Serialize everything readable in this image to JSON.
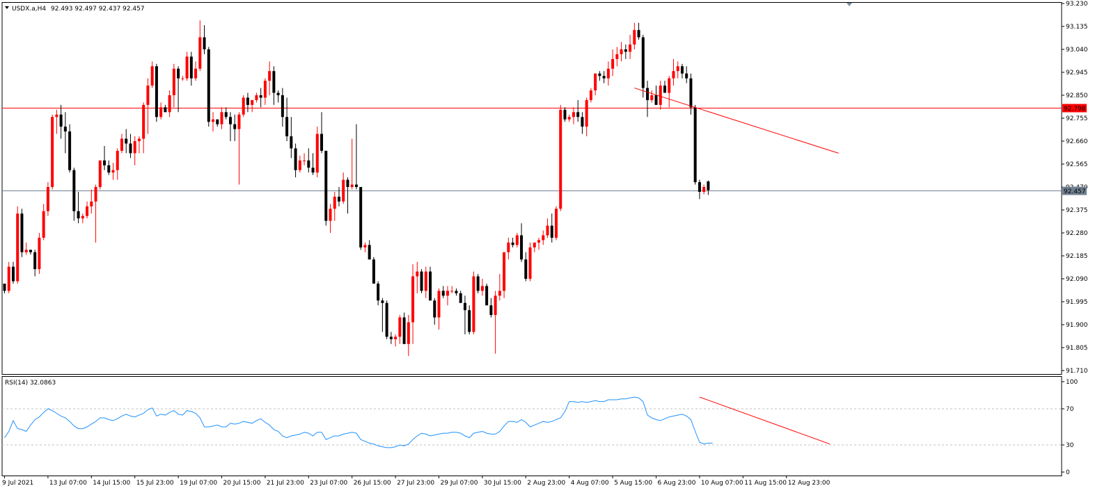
{
  "chart_data": [
    {
      "type": "candlestick",
      "symbol": "USDX.a,H4",
      "header_values": "92.493 92.497 92.437 92.457",
      "ylim": [
        91.71,
        93.23
      ],
      "y_ticks": [
        "93.230",
        "93.135",
        "93.040",
        "92.945",
        "92.850",
        "92.755",
        "92.660",
        "92.565",
        "92.470",
        "92.375",
        "92.280",
        "92.185",
        "92.090",
        "91.995",
        "91.900",
        "91.805",
        "91.710"
      ],
      "x_ticks": [
        "9 Jul 2021",
        "13 Jul 07:00",
        "14 Jul 15:00",
        "15 Jul 23:00",
        "19 Jul 07:00",
        "20 Jul 15:00",
        "21 Jul 23:00",
        "23 Jul 07:00",
        "26 Jul 15:00",
        "27 Jul 23:00",
        "29 Jul 07:00",
        "30 Jul 15:00",
        "2 Aug 23:00",
        "4 Aug 07:00",
        "5 Aug 15:00",
        "6 Aug 23:00",
        "10 Aug 07:00",
        "11 Aug 15:00",
        "12 Aug 23:00"
      ],
      "horizontal_lines": [
        {
          "label": "92.798",
          "price": 92.798,
          "color": "#ff0000"
        },
        {
          "label": "92.457",
          "price": 92.457,
          "color": "#708090"
        }
      ],
      "trendline": {
        "from": {
          "bar": 145,
          "price": 92.88
        },
        "to": {
          "bar": 192,
          "price": 92.61
        }
      },
      "up_color": "#ff0000",
      "down_color": "#000000",
      "candles": [
        [
          92.07,
          92.07,
          92.03,
          92.04
        ],
        [
          92.04,
          92.16,
          92.03,
          92.14
        ],
        [
          92.14,
          92.16,
          92.07,
          92.08
        ],
        [
          92.08,
          92.39,
          92.07,
          92.36
        ],
        [
          92.36,
          92.38,
          92.18,
          92.2
        ],
        [
          92.2,
          92.24,
          92.19,
          92.21
        ],
        [
          92.21,
          92.21,
          92.19,
          92.2
        ],
        [
          92.2,
          92.21,
          92.1,
          92.13
        ],
        [
          92.13,
          92.28,
          92.11,
          92.26
        ],
        [
          92.26,
          92.4,
          92.25,
          92.37
        ],
        [
          92.37,
          92.49,
          92.35,
          92.47
        ],
        [
          92.47,
          92.77,
          92.46,
          92.76
        ],
        [
          92.76,
          92.79,
          92.69,
          92.77
        ],
        [
          92.77,
          92.81,
          92.67,
          92.72
        ],
        [
          92.72,
          92.78,
          92.61,
          92.7
        ],
        [
          92.7,
          92.73,
          92.53,
          92.54
        ],
        [
          92.54,
          92.55,
          92.33,
          92.37
        ],
        [
          92.37,
          92.45,
          92.32,
          92.34
        ],
        [
          92.34,
          92.36,
          92.32,
          92.35
        ],
        [
          92.35,
          92.41,
          92.34,
          92.39
        ],
        [
          92.39,
          92.46,
          92.36,
          92.41
        ],
        [
          92.41,
          92.48,
          92.24,
          92.47
        ],
        [
          92.47,
          92.58,
          92.46,
          92.58
        ],
        [
          92.58,
          92.64,
          92.54,
          92.56
        ],
        [
          92.56,
          92.58,
          92.52,
          92.53
        ],
        [
          92.53,
          92.57,
          92.5,
          92.54
        ],
        [
          92.54,
          92.63,
          92.5,
          92.62
        ],
        [
          92.62,
          92.69,
          92.61,
          92.67
        ],
        [
          92.67,
          92.71,
          92.61,
          92.65
        ],
        [
          92.65,
          92.69,
          92.59,
          92.61
        ],
        [
          92.61,
          92.68,
          92.56,
          92.66
        ],
        [
          92.66,
          92.68,
          92.61,
          92.67
        ],
        [
          92.67,
          92.82,
          92.61,
          92.81
        ],
        [
          92.81,
          92.92,
          92.69,
          92.89
        ],
        [
          92.89,
          92.99,
          92.88,
          92.97
        ],
        [
          92.97,
          92.98,
          92.74,
          92.76
        ],
        [
          92.76,
          92.82,
          92.75,
          92.8
        ],
        [
          92.8,
          92.81,
          92.78,
          92.78
        ],
        [
          92.78,
          92.87,
          92.76,
          92.85
        ],
        [
          92.85,
          92.98,
          92.8,
          92.96
        ],
        [
          92.96,
          92.97,
          92.78,
          92.92
        ],
        [
          92.92,
          92.93,
          92.91,
          92.92
        ],
        [
          92.92,
          93.03,
          92.91,
          93.01
        ],
        [
          93.01,
          93.03,
          92.89,
          92.92
        ],
        [
          92.92,
          92.99,
          92.91,
          92.96
        ],
        [
          92.96,
          93.16,
          92.95,
          93.09
        ],
        [
          93.09,
          93.14,
          93.02,
          93.04
        ],
        [
          93.04,
          93.05,
          92.72,
          92.74
        ],
        [
          92.74,
          92.78,
          92.7,
          92.75
        ],
        [
          92.75,
          92.75,
          92.72,
          92.73
        ],
        [
          92.73,
          92.8,
          92.71,
          92.78
        ],
        [
          92.78,
          92.8,
          92.75,
          92.76
        ],
        [
          92.76,
          92.78,
          92.66,
          92.73
        ],
        [
          92.73,
          92.77,
          92.66,
          92.71
        ],
        [
          92.71,
          92.78,
          92.48,
          92.77
        ],
        [
          92.77,
          92.85,
          92.76,
          92.84
        ],
        [
          92.84,
          92.86,
          92.78,
          92.81
        ],
        [
          92.81,
          92.83,
          92.78,
          92.83
        ],
        [
          92.83,
          92.86,
          92.82,
          92.85
        ],
        [
          92.85,
          92.88,
          92.8,
          92.84
        ],
        [
          92.84,
          92.92,
          92.81,
          92.91
        ],
        [
          92.91,
          92.99,
          92.85,
          92.95
        ],
        [
          92.95,
          92.97,
          92.81,
          92.86
        ],
        [
          92.86,
          92.87,
          92.82,
          92.85
        ],
        [
          92.85,
          92.88,
          92.72,
          92.76
        ],
        [
          92.76,
          92.84,
          92.66,
          92.68
        ],
        [
          92.68,
          92.76,
          92.59,
          92.63
        ],
        [
          92.63,
          92.65,
          92.51,
          92.54
        ],
        [
          92.54,
          92.6,
          92.53,
          92.58
        ],
        [
          92.58,
          92.61,
          92.56,
          92.58
        ],
        [
          92.58,
          92.63,
          92.53,
          92.55
        ],
        [
          92.55,
          92.61,
          92.52,
          92.53
        ],
        [
          92.53,
          92.72,
          92.51,
          92.69
        ],
        [
          92.69,
          92.78,
          92.61,
          92.62
        ],
        [
          92.62,
          92.62,
          92.31,
          92.33
        ],
        [
          92.33,
          92.4,
          92.28,
          92.38
        ],
        [
          92.38,
          92.45,
          92.33,
          92.43
        ],
        [
          92.43,
          92.47,
          92.39,
          92.41
        ],
        [
          92.41,
          92.53,
          92.4,
          92.5
        ],
        [
          92.5,
          92.51,
          92.36,
          92.47
        ],
        [
          92.47,
          92.67,
          92.46,
          92.48
        ],
        [
          92.48,
          92.73,
          92.46,
          92.47
        ],
        [
          92.47,
          92.47,
          92.21,
          92.22
        ],
        [
          92.22,
          92.24,
          92.2,
          92.23
        ],
        [
          92.23,
          92.25,
          92.17,
          92.17
        ],
        [
          92.17,
          92.18,
          92.07,
          92.07
        ],
        [
          92.07,
          92.08,
          91.98,
          92.0
        ],
        [
          92.0,
          92.01,
          91.87,
          91.99
        ],
        [
          91.99,
          92.0,
          91.84,
          91.85
        ],
        [
          91.85,
          91.87,
          91.82,
          91.84
        ],
        [
          91.84,
          91.86,
          91.81,
          91.85
        ],
        [
          91.85,
          91.94,
          91.82,
          91.93
        ],
        [
          91.93,
          91.95,
          91.82,
          91.82
        ],
        [
          91.82,
          91.94,
          91.77,
          91.91
        ],
        [
          91.91,
          92.15,
          91.82,
          92.1
        ],
        [
          92.1,
          92.16,
          92.03,
          92.12
        ],
        [
          92.12,
          92.13,
          92.03,
          92.04
        ],
        [
          92.04,
          92.14,
          92.01,
          92.12
        ],
        [
          92.12,
          92.14,
          92.02,
          92.0
        ],
        [
          92.0,
          92.01,
          91.9,
          91.93
        ],
        [
          91.93,
          92.05,
          91.88,
          92.04
        ],
        [
          92.04,
          92.06,
          92.01,
          92.02
        ],
        [
          92.02,
          92.06,
          91.98,
          92.04
        ],
        [
          92.04,
          92.06,
          92.03,
          92.04
        ],
        [
          92.04,
          92.05,
          92.02,
          92.03
        ],
        [
          92.03,
          92.04,
          91.99,
          91.99
        ],
        [
          91.99,
          92.02,
          91.86,
          91.96
        ],
        [
          91.96,
          91.98,
          91.86,
          91.87
        ],
        [
          91.87,
          92.12,
          91.86,
          92.1
        ],
        [
          92.1,
          92.11,
          92.03,
          92.04
        ],
        [
          92.04,
          92.09,
          92.02,
          92.06
        ],
        [
          92.06,
          92.07,
          91.98,
          91.98
        ],
        [
          91.98,
          92.01,
          91.93,
          91.94
        ],
        [
          91.94,
          92.04,
          91.78,
          92.02
        ],
        [
          92.02,
          92.11,
          92.0,
          92.04
        ],
        [
          92.04,
          92.2,
          92.01,
          92.2
        ],
        [
          92.2,
          92.26,
          92.17,
          92.24
        ],
        [
          92.24,
          92.26,
          92.22,
          92.23
        ],
        [
          92.23,
          92.28,
          92.22,
          92.27
        ],
        [
          92.27,
          92.32,
          92.16,
          92.17
        ],
        [
          92.17,
          92.2,
          92.08,
          92.09
        ],
        [
          92.09,
          92.24,
          92.08,
          92.22
        ],
        [
          92.22,
          92.24,
          92.2,
          92.24
        ],
        [
          92.24,
          92.26,
          92.21,
          92.25
        ],
        [
          92.25,
          92.29,
          92.23,
          92.27
        ],
        [
          92.27,
          92.34,
          92.26,
          92.31
        ],
        [
          92.31,
          92.36,
          92.24,
          92.26
        ],
        [
          92.26,
          92.39,
          92.25,
          92.38
        ],
        [
          92.38,
          92.81,
          92.37,
          92.79
        ],
        [
          92.79,
          92.8,
          92.74,
          92.75
        ],
        [
          92.75,
          92.77,
          92.74,
          92.76
        ],
        [
          92.76,
          92.8,
          92.73,
          92.78
        ],
        [
          92.78,
          92.83,
          92.74,
          92.76
        ],
        [
          92.76,
          92.78,
          92.69,
          92.72
        ],
        [
          92.72,
          92.84,
          92.68,
          92.83
        ],
        [
          92.83,
          92.88,
          92.82,
          92.87
        ],
        [
          92.87,
          92.94,
          92.85,
          92.94
        ],
        [
          92.94,
          92.95,
          92.91,
          92.93
        ],
        [
          92.93,
          92.95,
          92.9,
          92.92
        ],
        [
          92.92,
          92.99,
          92.89,
          92.96
        ],
        [
          92.96,
          93.04,
          92.93,
          93.0
        ],
        [
          93.0,
          93.05,
          92.97,
          93.02
        ],
        [
          93.02,
          93.07,
          92.99,
          93.04
        ],
        [
          93.04,
          93.06,
          93.0,
          93.03
        ],
        [
          93.03,
          93.1,
          93.0,
          93.06
        ],
        [
          93.06,
          93.15,
          93.04,
          93.12
        ],
        [
          93.12,
          93.15,
          93.08,
          93.09
        ],
        [
          93.09,
          93.1,
          92.84,
          92.88
        ],
        [
          92.88,
          92.91,
          92.76,
          92.83
        ],
        [
          92.83,
          92.87,
          92.82,
          92.85
        ],
        [
          92.85,
          92.89,
          92.81,
          92.81
        ],
        [
          92.81,
          92.91,
          92.79,
          92.89
        ],
        [
          92.89,
          92.91,
          92.86,
          92.86
        ],
        [
          92.86,
          92.93,
          92.8,
          92.92
        ],
        [
          92.92,
          93.0,
          92.89,
          92.95
        ],
        [
          92.95,
          92.99,
          92.92,
          92.97
        ],
        [
          92.97,
          92.98,
          92.92,
          92.94
        ],
        [
          92.94,
          92.97,
          92.9,
          92.92
        ],
        [
          92.92,
          92.94,
          92.77,
          92.8
        ],
        [
          92.8,
          92.81,
          92.48,
          92.49
        ],
        [
          92.49,
          92.5,
          92.42,
          92.45
        ],
        [
          92.45,
          92.48,
          92.44,
          92.47
        ],
        [
          92.493,
          92.497,
          92.437,
          92.457
        ]
      ]
    },
    {
      "type": "line",
      "title": "RSI(14) 32.0863",
      "ylim": [
        0,
        100
      ],
      "y_ticks": [
        "100",
        "70",
        "30",
        "0"
      ],
      "levels": [
        70,
        30
      ],
      "series_color": "#1e90ff",
      "trendline": {
        "from": {
          "bar": 160,
          "value": 83
        },
        "to": {
          "bar": 190,
          "value": 31
        }
      },
      "values": [
        38,
        45,
        57,
        48,
        47,
        45,
        52,
        58,
        61,
        66,
        70,
        68,
        65,
        62,
        60,
        56,
        51,
        48,
        48,
        50,
        53,
        56,
        60,
        60,
        58,
        57,
        59,
        62,
        64,
        62,
        61,
        63,
        65,
        69,
        71,
        62,
        64,
        63,
        66,
        68,
        64,
        63,
        68,
        67,
        65,
        60,
        50,
        50,
        51,
        52,
        50,
        50,
        54,
        53,
        54,
        56,
        55,
        54,
        57,
        59,
        55,
        52,
        47,
        45,
        40,
        38,
        40,
        41,
        42,
        44,
        43,
        40,
        44,
        44,
        36,
        38,
        40,
        40,
        42,
        43,
        44,
        43,
        36,
        34,
        32,
        31,
        29,
        28,
        27,
        27,
        28,
        30,
        29,
        31,
        36,
        40,
        43,
        42,
        40,
        41,
        42,
        43,
        43,
        44,
        44,
        43,
        40,
        38,
        43,
        44,
        45,
        43,
        42,
        42,
        45,
        51,
        56,
        56,
        55,
        58,
        55,
        50,
        52,
        54,
        56,
        55,
        56,
        58,
        60,
        67,
        78,
        78,
        77,
        78,
        77,
        78,
        79,
        78,
        78,
        80,
        80,
        80,
        81,
        81,
        82,
        83,
        82,
        78,
        63,
        60,
        58,
        57,
        59,
        61,
        62,
        63,
        64,
        62,
        58,
        45,
        33,
        31,
        32,
        32
      ]
    }
  ]
}
